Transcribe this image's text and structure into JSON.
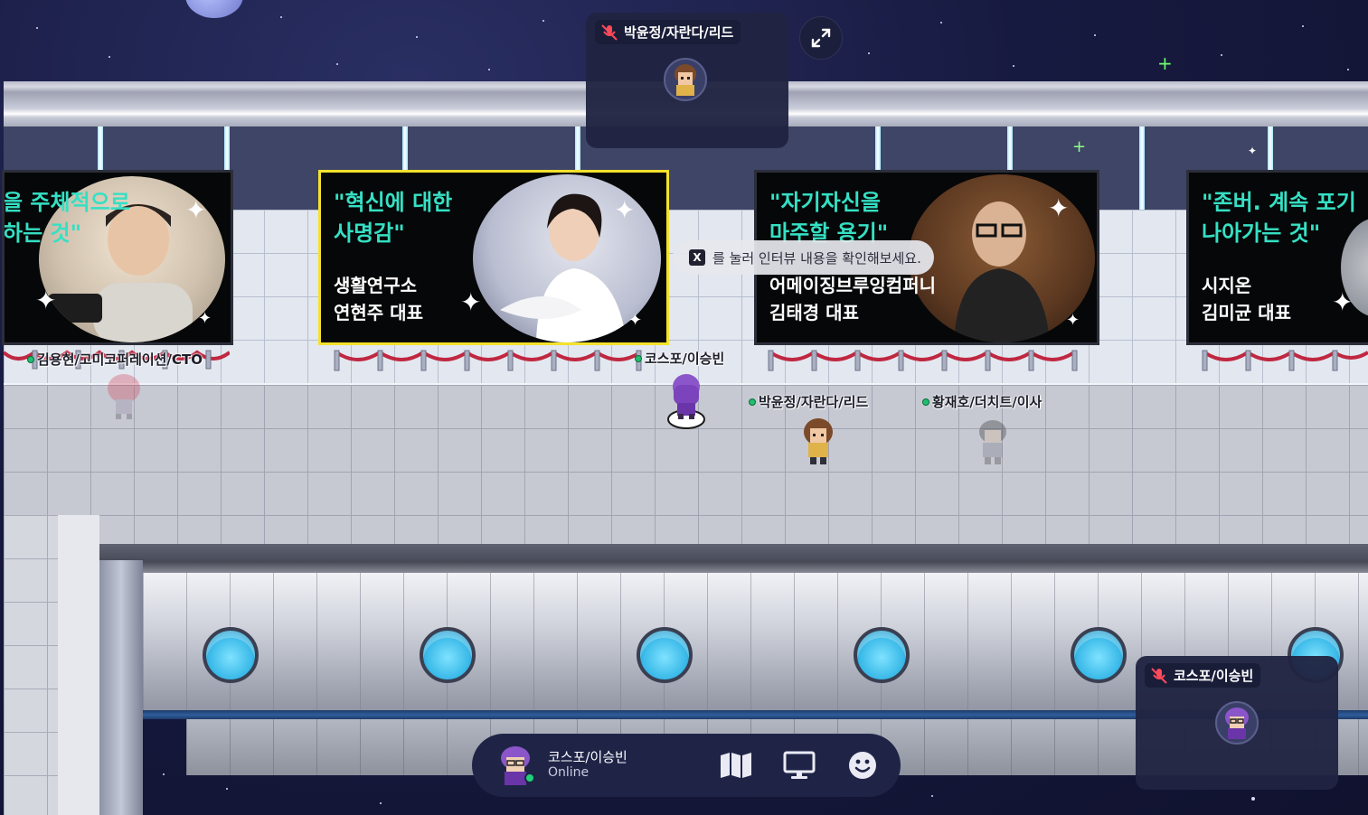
{
  "banners": [
    {
      "quote": "을 주체적으로\n하는 것\"",
      "who": ""
    },
    {
      "quote": "\"혁신에 대한\n사명감\"",
      "who": "생활연구소\n연현주 대표"
    },
    {
      "quote": "\"자기자신을\n마주할 용기\"",
      "who": "어메이징브루잉컴퍼니\n김태경 대표"
    },
    {
      "quote": "\"존버. 계속 포기\n나아가는 것\"",
      "who": "시지온\n김미균 대표"
    }
  ],
  "hint": {
    "key": "X",
    "text": "를 눌러 인터뷰 내용을 확인해보세요."
  },
  "players": [
    {
      "name": "김용현/고미코퍼레이션/CTO"
    },
    {
      "name": "코스포/이승빈"
    },
    {
      "name": "박윤정/자란다/리드"
    },
    {
      "name": "황재호/더치트/이사"
    }
  ],
  "video_tiles": {
    "top": {
      "name": "박윤정/자란다/리드",
      "mic": "muted"
    },
    "bottom_right": {
      "name": "코스포/이승빈",
      "mic": "muted"
    }
  },
  "control_bar": {
    "name": "코스포/이승빈",
    "status": "Online",
    "buttons": [
      "map-icon",
      "screen-share-icon",
      "emoji-icon"
    ]
  },
  "colors": {
    "quote_accent": "#35e0c4",
    "online_dot": "#21d07a",
    "banner_highlight": "#f4e22c",
    "panel_bg": "#1f2447"
  }
}
